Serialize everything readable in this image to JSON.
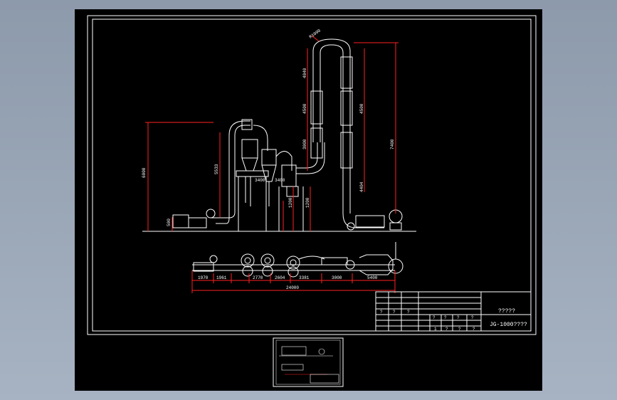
{
  "viewport": {
    "background": "#9aa6b7",
    "paper_color": "#000000",
    "line_color": "#ffffff",
    "dimension_color": "#ff2020",
    "accent_color": "#ffff00"
  },
  "title_block": {
    "name": "?????",
    "drawing_code": "JG-1000????",
    "parts_col_labels": [
      "?",
      "?",
      "?",
      "?",
      "?",
      "?",
      "?"
    ],
    "bottom_row": [
      "1",
      "?",
      "?",
      "?"
    ]
  },
  "elevation_dims": {
    "left_height": "6000",
    "cyclone_height": "5533",
    "right_height": "7400",
    "base_height": "500",
    "riser_segments": [
      "4040",
      "4500",
      "3000",
      "4500",
      "4404"
    ],
    "bend_label": "R1000",
    "mid_labels": [
      "3400",
      "3400",
      "1200",
      "1200"
    ]
  },
  "plan_dims": {
    "segments": [
      "1970",
      "1961",
      "2770",
      "2604",
      "3381",
      "3000",
      "5400"
    ],
    "overall": "24000"
  },
  "icons": [
    "thumbnail-preview"
  ]
}
